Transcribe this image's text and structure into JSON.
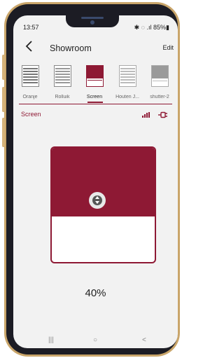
{
  "status": {
    "time": "13:57",
    "battery": "85%",
    "icons": "✱ ◌ .ıl 85%▮"
  },
  "header": {
    "title": "Showroom",
    "edit_label": "Edit"
  },
  "devices": [
    {
      "label": "Oranje",
      "icon": "blinds-icon"
    },
    {
      "label": "Rolluik",
      "icon": "blinds-icon"
    },
    {
      "label": "Screen",
      "icon": "screen-icon"
    },
    {
      "label": "Houten J...",
      "icon": "blinds-icon"
    },
    {
      "label": "shutter-2",
      "icon": "shutter-icon"
    }
  ],
  "section": {
    "name": "Screen"
  },
  "control": {
    "position_percent": 40,
    "position_label": "40%"
  },
  "nav": {
    "recent": "|||",
    "home": "○",
    "back": "<"
  },
  "colors": {
    "accent": "#8e1934",
    "background": "#f2f2f2"
  }
}
